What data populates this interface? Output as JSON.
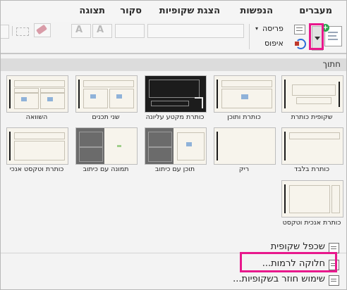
{
  "ribbon": {
    "tabs": [
      "מעברים",
      "הנפשות",
      "הצגת שקופיות",
      "סקור",
      "תצוגה"
    ]
  },
  "toolbar": {
    "layout_label": "פריסה",
    "reset_label": "איפוס",
    "font_grow_label": "A",
    "font_shrink_label": "A"
  },
  "panel": {
    "section_title": "חתוך",
    "layouts": [
      "שקופית כותרת",
      "כותרת ותוכן",
      "כותרת מקטע עליונה",
      "שני תכנים",
      "השוואה",
      "כותרת בלבד",
      "ריק",
      "תוכן עם כיתוב",
      "תמונה עם כיתוב",
      "כותרת וטקסט אנכי",
      "כותרת אנכית וטקסט"
    ],
    "menu": [
      "שכפל שקופית",
      "חלוקה לרמות...",
      "שימוש חוזר בשקופיות..."
    ]
  },
  "colors": {
    "highlight": "#e8188c",
    "accent_green": "#2ea44f"
  }
}
